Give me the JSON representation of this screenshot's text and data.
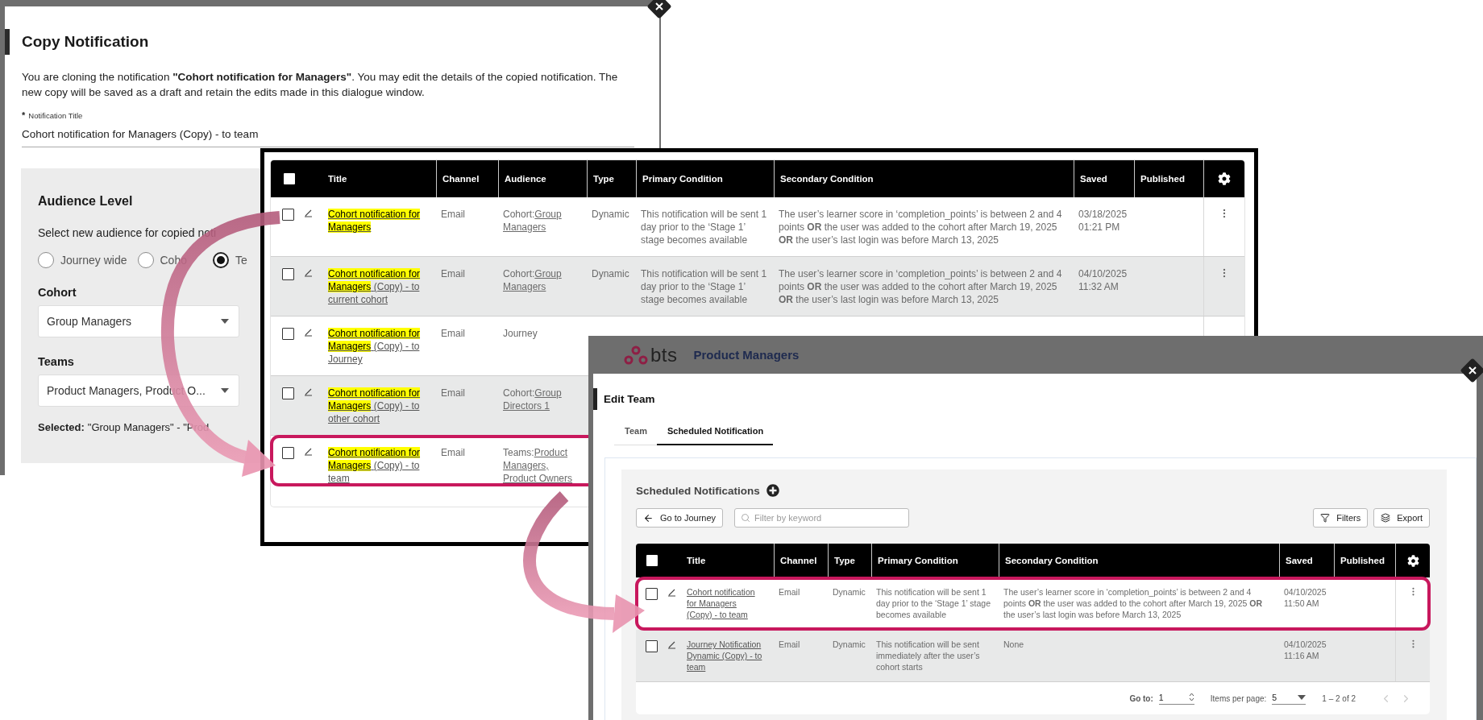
{
  "copy_dialog": {
    "title": "Copy Notification",
    "description": "You are cloning the notification **\"Cohort notification for Managers\"**. You may edit the details of the copied notification. The new copy will be saved as a draft and retain the edits made in this dialogue window.",
    "title_field": {
      "required_mark": "*",
      "label": "Notification Title",
      "value": "Cohort notification for Managers (Copy) - to team"
    },
    "audience": {
      "heading": "Audience Level",
      "prompt": "Select new audience for copied noti",
      "options": [
        {
          "label": "Journey wide",
          "selected": false
        },
        {
          "label": "Coho",
          "selected": false
        },
        {
          "label": "Te",
          "selected": true
        }
      ],
      "cohort_label": "Cohort",
      "cohort_value": "Group Managers",
      "teams_label": "Teams",
      "teams_value": "Product Managers, Product O...",
      "selected_label": "Selected:",
      "selected_value": "\"Group Managers\" - \"Prod"
    }
  },
  "notifications_table": {
    "select_all_checked": false,
    "columns": [
      "Title",
      "Channel",
      "Audience",
      "Type",
      "Primary Condition",
      "Secondary Condition",
      "Saved",
      "Published"
    ],
    "rows": [
      {
        "checked": false,
        "highlighted": false,
        "title": {
          "highlight": "Cohort notification for Managers"
        },
        "channel": "Email",
        "audience": {
          "prefix": "Cohort:",
          "link": "Group Managers"
        },
        "type": "Dynamic",
        "primary": "This notification will be sent 1 day prior to the ‘Stage 1’ stage becomes available",
        "secondary": "The user’s learner score in ‘completion_points’ is between 2 and 4 points **OR** the user was added to the cohort after March 19, 2025 **OR** the user’s last login was before March 13, 2025",
        "saved_date": "03/18/2025",
        "saved_time": "01:21 PM"
      },
      {
        "checked": false,
        "highlighted": false,
        "title": {
          "highlight": "Cohort notification for Managers",
          "rest": "(Copy) - to current cohort"
        },
        "channel": "Email",
        "audience": {
          "prefix": "Cohort:",
          "link": "Group Managers"
        },
        "type": "Dynamic",
        "primary": "This notification will be sent 1 day prior to the ‘Stage 1’ stage becomes available",
        "secondary": "The user’s learner score in ‘completion_points’ is between 2 and 4 points **OR** the user was added to the cohort after March 19, 2025 **OR** the user’s last login was before March 13, 2025",
        "saved_date": "04/10/2025",
        "saved_time": "11:32 AM"
      },
      {
        "checked": false,
        "highlighted": false,
        "title": {
          "highlight": "Cohort notification for Managers",
          "rest": "(Copy) - to Journey"
        },
        "channel": "Email",
        "audience": {
          "prefix": "Journey"
        }
      },
      {
        "checked": false,
        "highlighted": false,
        "title": {
          "highlight": "Cohort notification for Managers",
          "rest": "(Copy) - to other cohort"
        },
        "channel": "Email",
        "audience": {
          "prefix": "Cohort:",
          "link": "Group Directors 1"
        }
      },
      {
        "checked": false,
        "highlighted": true,
        "title": {
          "highlight": "Cohort notification for Managers",
          "rest": "(Copy) - to team"
        },
        "channel": "Email",
        "audience": {
          "prefix": "Teams:",
          "link": "Product Managers, Product Owners"
        }
      }
    ]
  },
  "edit_team": {
    "brand": "bts",
    "team_name": "Product Managers",
    "title": "Edit Team",
    "tabs": [
      {
        "label": "Team",
        "selected": false
      },
      {
        "label": "Scheduled Notification",
        "selected": true
      }
    ],
    "section_title": "Scheduled Notifications",
    "back_button": "Go to Journey",
    "filter_placeholder": "Filter by keyword",
    "filters_button": "Filters",
    "export_button": "Export",
    "select_all_checked": false,
    "columns": [
      "Title",
      "Channel",
      "Type",
      "Primary Condition",
      "Secondary Condition",
      "Saved",
      "Published"
    ],
    "rows": [
      {
        "checked": false,
        "highlighted": true,
        "title": "Cohort notification for Managers (Copy) - to team",
        "channel": "Email",
        "type": "Dynamic",
        "primary": "This notification will be sent 1 day prior to the ‘Stage 1’ stage becomes available",
        "secondary": "The user’s learner score in ‘completion_points’ is between 2 and 4 points **OR** the user was added to the cohort after March 19, 2025 **OR** the user’s last login was before March 13, 2025",
        "saved_date": "04/10/2025",
        "saved_time": "11:50 AM"
      },
      {
        "checked": false,
        "highlighted": false,
        "title": "Journey Notification Dynamic (Copy) - to team",
        "channel": "Email",
        "type": "Dynamic",
        "primary": "This notification will be sent immediately after the user’s cohort starts",
        "secondary": "None",
        "saved_date": "04/10/2025",
        "saved_time": "11:16 AM"
      }
    ],
    "pagination": {
      "goto_label": "Go to:",
      "goto_value": "1",
      "per_page_label": "Items per page:",
      "per_page_value": "5",
      "range": "1 – 2 of 2"
    }
  }
}
